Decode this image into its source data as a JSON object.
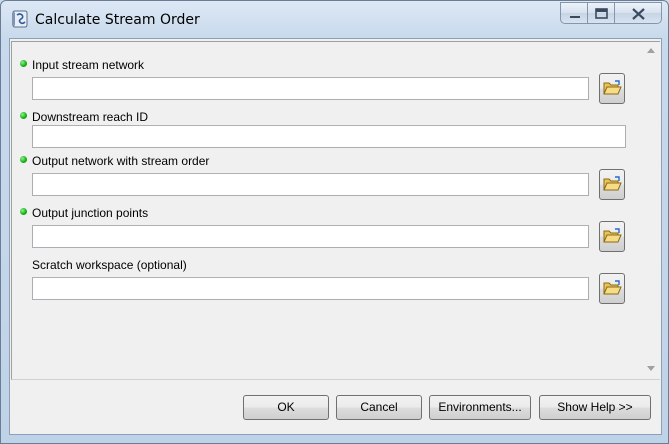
{
  "window": {
    "title": "Calculate Stream Order",
    "icon": "script-tool-icon"
  },
  "parameters": [
    {
      "label": "Input stream network",
      "required": true,
      "value": "",
      "has_browse": true
    },
    {
      "label": "Downstream reach ID",
      "required": true,
      "value": "",
      "has_browse": false
    },
    {
      "label": "Output network with stream order",
      "required": true,
      "value": "",
      "has_browse": true
    },
    {
      "label": "Output junction points",
      "required": true,
      "value": "",
      "has_browse": true
    },
    {
      "label": "Scratch workspace (optional)",
      "required": false,
      "value": "",
      "has_browse": true
    }
  ],
  "buttons": {
    "ok": "OK",
    "cancel": "Cancel",
    "environments": "Environments...",
    "show_help": "Show Help >>"
  },
  "colors": {
    "required_indicator": "#10b010",
    "title_bar": "#c7d9ec",
    "client_background": "#f0f0f0"
  }
}
